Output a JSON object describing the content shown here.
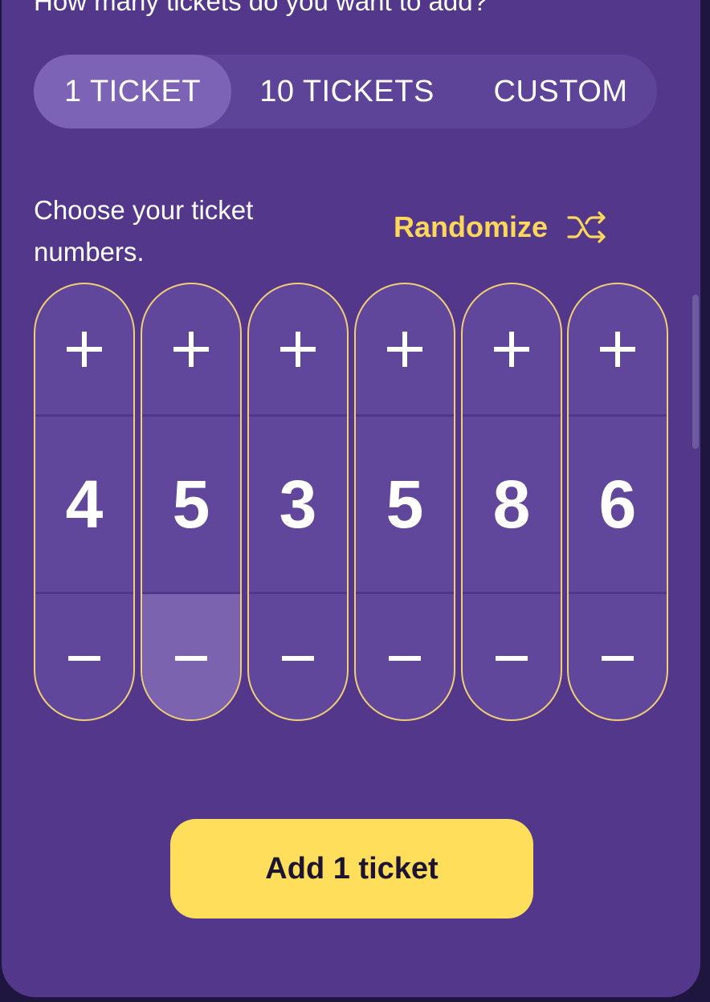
{
  "header": {
    "question": "How many tickets do you want to add?"
  },
  "quantity_tabs": [
    {
      "label": "1 TICKET",
      "active": true
    },
    {
      "label": "10 TICKETS",
      "active": false
    },
    {
      "label": "CUSTOM",
      "active": false
    }
  ],
  "instruction": "Choose your ticket numbers.",
  "randomize": {
    "label": "Randomize",
    "icon": "shuffle-icon"
  },
  "pickers": [
    {
      "digit": "4",
      "increment_icon": "plus-icon",
      "decrement_icon": "minus-icon"
    },
    {
      "digit": "5",
      "increment_icon": "plus-icon",
      "decrement_icon": "minus-icon"
    },
    {
      "digit": "3",
      "increment_icon": "plus-icon",
      "decrement_icon": "minus-icon"
    },
    {
      "digit": "5",
      "increment_icon": "plus-icon",
      "decrement_icon": "minus-icon"
    },
    {
      "digit": "8",
      "increment_icon": "plus-icon",
      "decrement_icon": "minus-icon"
    },
    {
      "digit": "6",
      "increment_icon": "plus-icon",
      "decrement_icon": "minus-icon"
    }
  ],
  "add_button": {
    "label": "Add 1 ticket"
  },
  "colors": {
    "background": "#52378b",
    "accent_yellow": "#ffd75a",
    "button_yellow": "#ffde5c",
    "picker_border": "#f1cf78",
    "active_tab": "#7c63b6"
  }
}
